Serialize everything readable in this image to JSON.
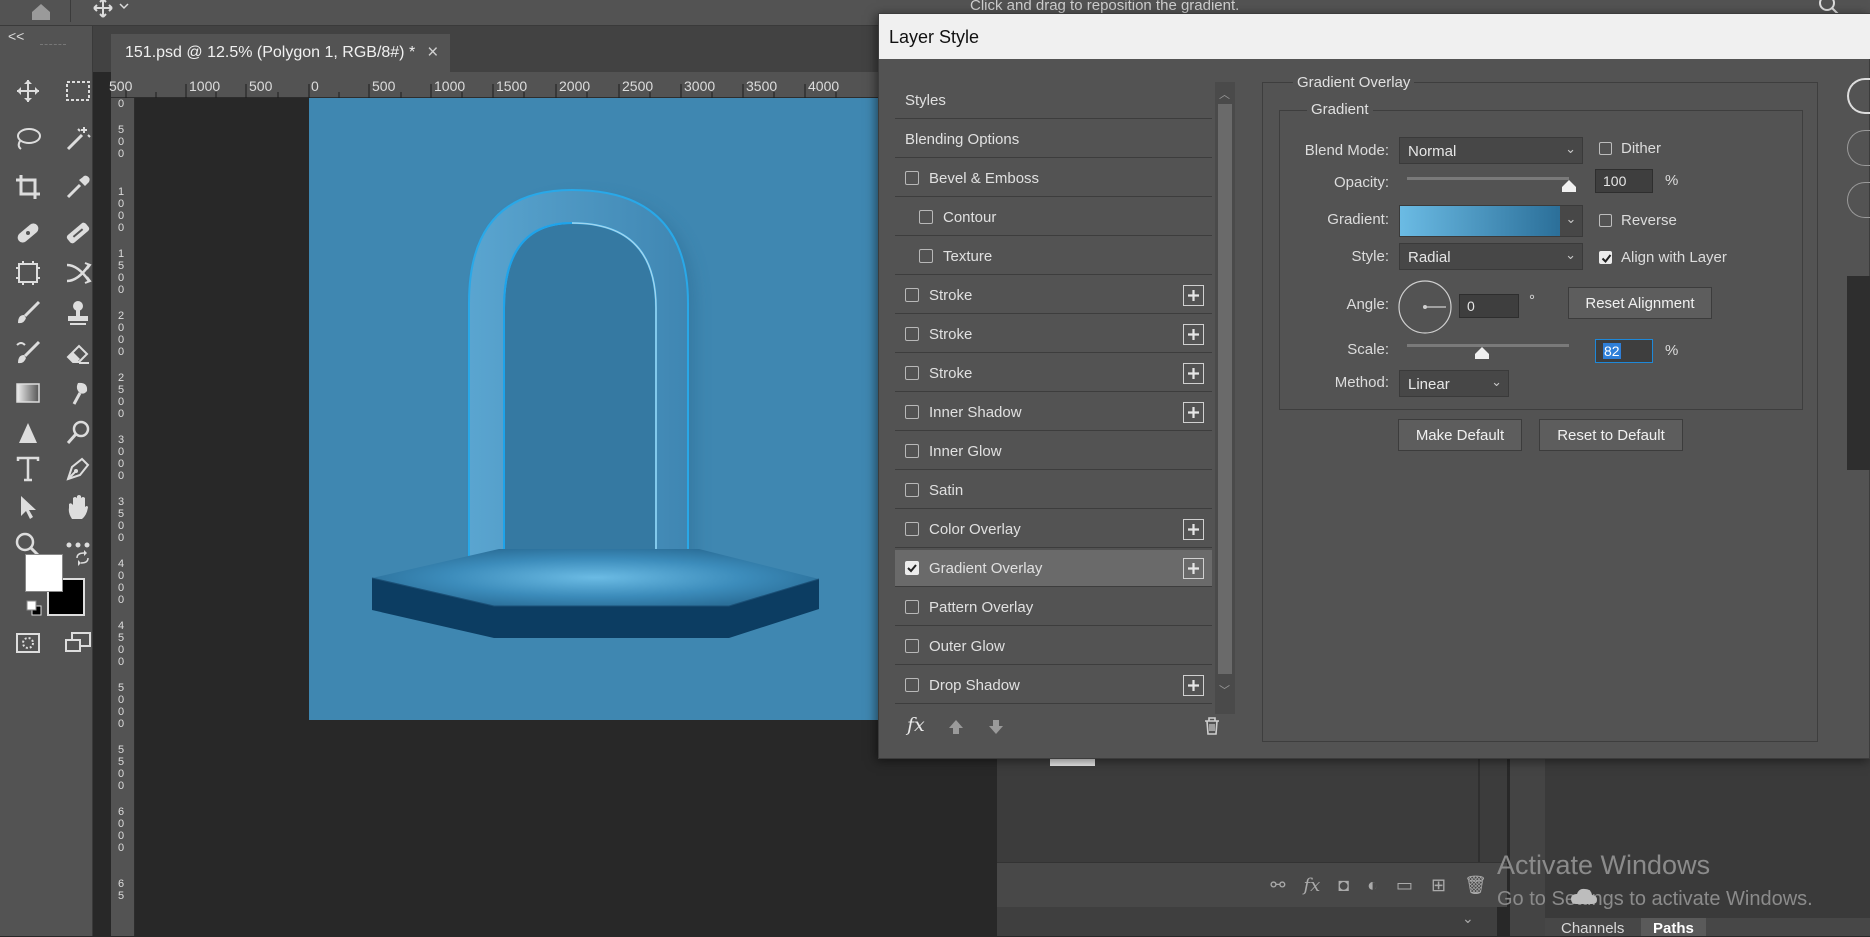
{
  "app": {
    "hint": "Click and drag to reposition the gradient.",
    "doc_tab": "151.psd @ 12.5% (Polygon 1, RGB/8#) *",
    "close_glyph": "×",
    "collapse_glyph": "<<"
  },
  "rulers": {
    "top": [
      "500",
      "1000",
      "500",
      "0",
      "500",
      "1000",
      "1500",
      "2000",
      "2500",
      "3000",
      "3500",
      "4000"
    ],
    "left": [
      "0",
      "5 0 0",
      "1 0 0 0",
      "1 5 0 0",
      "2 0 0 0",
      "2 5 0 0",
      "3 0 0 0",
      "3 5 0 0",
      "4 0 0 0",
      "4 5 0 0",
      "5 0 0 0",
      "5 5 0 0",
      "6 0 0 0",
      "6 5"
    ]
  },
  "toolbar": {
    "icons": [
      "move-icon",
      "marquee-icon",
      "lasso-icon",
      "magic-wand-icon",
      "crop-icon",
      "eyedropper-icon",
      "healing-brush-icon",
      "patch-icon",
      "content-aware-icon",
      "swap-icon",
      "brush-icon",
      "stamp-icon",
      "history-brush-icon",
      "eraser-icon",
      "gradient-icon",
      "smudge-icon",
      "triangle-icon",
      "dodge-icon",
      "type-icon",
      "pen-icon",
      "path-select-icon",
      "hand-icon",
      "zoom-icon",
      "more-icon"
    ]
  },
  "dialog": {
    "title": "Layer Style",
    "styles_header": "Styles",
    "items": [
      {
        "label": "Blending Options",
        "checkbox": false,
        "checked": false,
        "plus": false,
        "indent": 0
      },
      {
        "label": "Bevel & Emboss",
        "checkbox": true,
        "checked": false,
        "plus": false,
        "indent": 0
      },
      {
        "label": "Contour",
        "checkbox": true,
        "checked": false,
        "plus": false,
        "indent": 1
      },
      {
        "label": "Texture",
        "checkbox": true,
        "checked": false,
        "plus": false,
        "indent": 1
      },
      {
        "label": "Stroke",
        "checkbox": true,
        "checked": false,
        "plus": true,
        "indent": 0
      },
      {
        "label": "Stroke",
        "checkbox": true,
        "checked": false,
        "plus": true,
        "indent": 0
      },
      {
        "label": "Stroke",
        "checkbox": true,
        "checked": false,
        "plus": true,
        "indent": 0
      },
      {
        "label": "Inner Shadow",
        "checkbox": true,
        "checked": false,
        "plus": true,
        "indent": 0
      },
      {
        "label": "Inner Glow",
        "checkbox": true,
        "checked": false,
        "plus": false,
        "indent": 0
      },
      {
        "label": "Satin",
        "checkbox": true,
        "checked": false,
        "plus": false,
        "indent": 0
      },
      {
        "label": "Color Overlay",
        "checkbox": true,
        "checked": false,
        "plus": true,
        "indent": 0
      },
      {
        "label": "Gradient Overlay",
        "checkbox": true,
        "checked": true,
        "plus": true,
        "indent": 0,
        "selected": true
      },
      {
        "label": "Pattern Overlay",
        "checkbox": true,
        "checked": false,
        "plus": false,
        "indent": 0
      },
      {
        "label": "Outer Glow",
        "checkbox": true,
        "checked": false,
        "plus": false,
        "indent": 0
      },
      {
        "label": "Drop Shadow",
        "checkbox": true,
        "checked": false,
        "plus": true,
        "indent": 0
      }
    ],
    "footer_fx": "fx",
    "section_title": "Gradient Overlay",
    "group_title": "Gradient",
    "blend_mode_label": "Blend Mode:",
    "blend_mode_value": "Normal",
    "dither_label": "Dither",
    "dither_checked": false,
    "opacity_label": "Opacity:",
    "opacity_value": "100",
    "opacity_fraction": 1.0,
    "percent": "%",
    "gradient_label": "Gradient:",
    "reverse_label": "Reverse",
    "reverse_checked": false,
    "style_label": "Style:",
    "style_value": "Radial",
    "align_label": "Align with Layer",
    "align_checked": true,
    "angle_label": "Angle:",
    "angle_value": "0",
    "degree": "°",
    "reset_alignment": "Reset Alignment",
    "scale_label": "Scale:",
    "scale_value": "82",
    "scale_fraction": 0.46,
    "method_label": "Method:",
    "method_value": "Linear",
    "make_default": "Make Default",
    "reset_default": "Reset to Default"
  },
  "windows": {
    "line1": "Activate Windows",
    "line2": "Go to Settings to activate Windows."
  },
  "panels": {
    "channels_tab": "Channels",
    "paths_tab": "Paths"
  },
  "colors": {
    "canvas_bg": "#3f87b1",
    "arch": "#4a95c2",
    "gradient_start": "#6bbbe4",
    "gradient_end": "#2b6f99"
  }
}
